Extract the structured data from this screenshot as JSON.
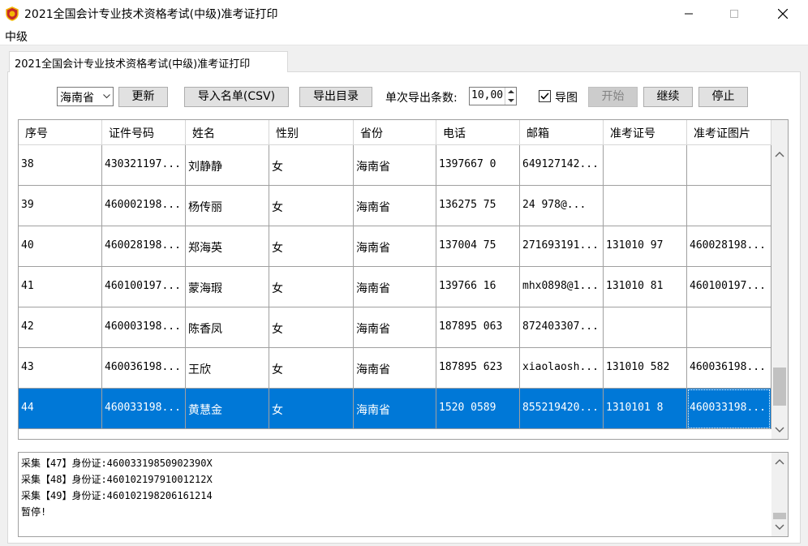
{
  "window": {
    "title": "2021全国会计专业技术资格考试(中级)准考证打印",
    "menu": [
      "中级"
    ],
    "tab_label": "2021全国会计专业技术资格考试(中级)准考证打印"
  },
  "toolbar": {
    "province_value": "海南省",
    "refresh_label": "更新",
    "import_label": "导入名单(CSV)",
    "export_dir_label": "导出目录",
    "batch_label": "单次导出条数:",
    "batch_value": "10,00",
    "export_image_label": "导图",
    "export_image_checked": true,
    "start_label": "开始",
    "continue_label": "继续",
    "stop_label": "停止"
  },
  "table": {
    "columns": [
      "序号",
      "证件号码",
      "姓名",
      "性别",
      "省份",
      "电话",
      "邮箱",
      "准考证号",
      "准考证图片"
    ],
    "rows": [
      [
        "38",
        "430321197...",
        "刘静静",
        "女",
        "海南省",
        "1397667   0",
        "649127142...",
        "",
        ""
      ],
      [
        "39",
        "460002198...",
        "杨传丽",
        "女",
        "海南省",
        "136275   75",
        "24   978@...",
        "",
        ""
      ],
      [
        "40",
        "460028198...",
        "郑海英",
        "女",
        "海南省",
        "137004   75",
        "271693191...",
        "131010   97",
        "460028198..."
      ],
      [
        "41",
        "460100197...",
        "蒙海瑕",
        "女",
        "海南省",
        "139766   16",
        "mhx0898@1...",
        "131010   81",
        "460100197..."
      ],
      [
        "42",
        "460003198...",
        "陈香凤",
        "女",
        "海南省",
        "187895   063",
        "872403307...",
        "",
        ""
      ],
      [
        "43",
        "460036198...",
        "王欣",
        "女",
        "海南省",
        "187895   623",
        "xiaolaosh...",
        "131010   582",
        "460036198..."
      ],
      [
        "44",
        "460033198...",
        "黄慧金",
        "女",
        "海南省",
        "1520   0589",
        "855219420...",
        "1310101   8",
        "460033198..."
      ]
    ],
    "selected_row": 6
  },
  "log": {
    "lines": [
      "采集【47】身份证:46003319850902390X",
      "采集【48】身份证:46010219791001212X",
      "采集【49】身份证:460102198206161214",
      "暂停!"
    ]
  },
  "colors": {
    "selection": "#0078d7",
    "app_icon_red": "#c62828",
    "app_icon_gold": "#f2b705"
  }
}
